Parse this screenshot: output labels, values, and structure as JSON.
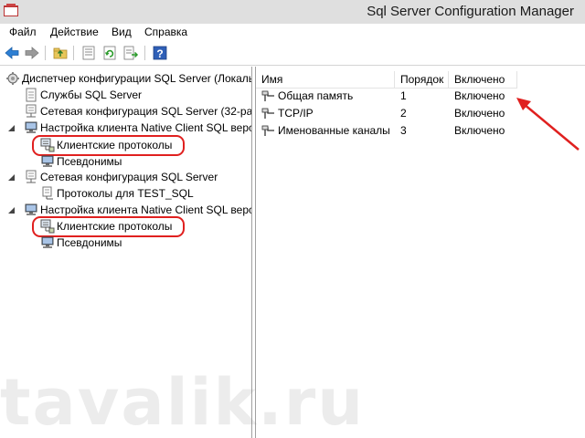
{
  "window": {
    "title": "Sql Server Configuration Manager"
  },
  "menu": {
    "items": [
      "Файл",
      "Действие",
      "Вид",
      "Справка"
    ]
  },
  "tree": {
    "root": "Диспетчер конфигурации SQL Server (Локаль",
    "services": "Службы SQL Server",
    "network32": "Сетевая конфигурация SQL Server (32-разр",
    "native_client_32": "Настройка клиента Native Client SQL верс",
    "client_protocols_32": "Клиентские протоколы",
    "aliases_32": "Псевдонимы",
    "network": "Сетевая конфигурация SQL Server",
    "protocols_test_sql": "Протоколы для TEST_SQL",
    "native_client": "Настройка клиента Native Client SQL верс",
    "client_protocols": "Клиентские протоколы",
    "aliases": "Псевдонимы"
  },
  "list": {
    "columns": [
      "Имя",
      "Порядок",
      "Включено"
    ],
    "rows": [
      {
        "name": "Общая память",
        "order": "1",
        "enabled": "Включено"
      },
      {
        "name": "TCP/IP",
        "order": "2",
        "enabled": "Включено"
      },
      {
        "name": "Именованные каналы",
        "order": "3",
        "enabled": "Включено"
      }
    ]
  },
  "watermark": "tavalik.ru",
  "colors": {
    "highlight": "#e0201f",
    "arrow": "#e0201f",
    "titlebar": "#dfdfdf"
  }
}
